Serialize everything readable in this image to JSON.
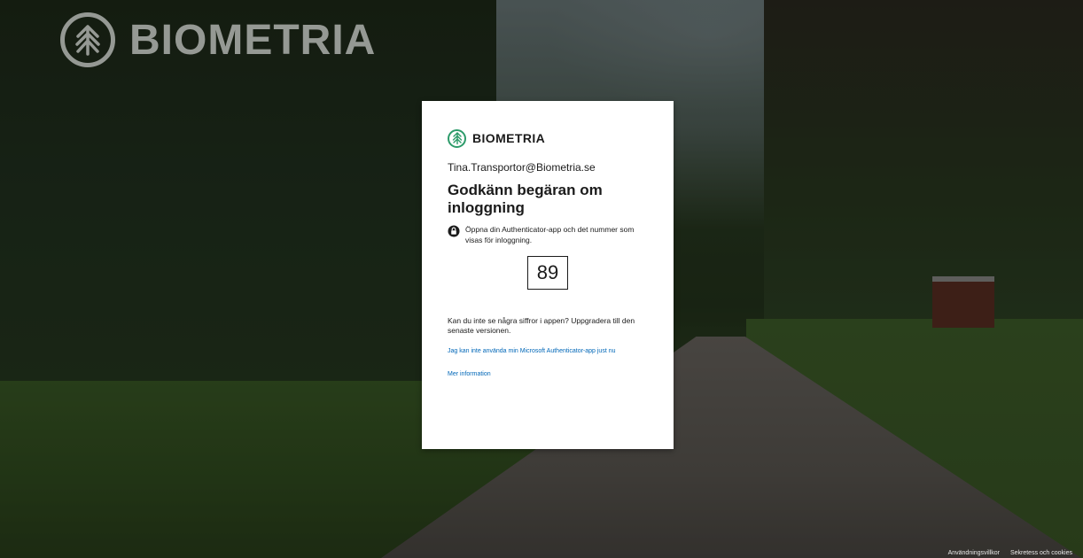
{
  "background": {
    "logo_text": "BIOMETRIA"
  },
  "card": {
    "brand_name": "BIOMETRIA",
    "identity": "Tina.Transportor@Biometria.se",
    "title": "Godkänn begäran om inloggning",
    "instruction": "Öppna din Authenticator-app och det nummer som visas för inloggning.",
    "number": "89",
    "upgrade_text": "Kan du inte se några siffror i appen? Uppgradera till den senaste versionen.",
    "link_cannot_use": "Jag kan inte använda min Microsoft Authenticator-app just nu",
    "link_more_info": "Mer information"
  },
  "footer": {
    "terms": "Användningsvillkor",
    "privacy": "Sekretess och cookies"
  },
  "colors": {
    "brand_green": "#2d9b6a",
    "link_blue": "#0067b8"
  }
}
